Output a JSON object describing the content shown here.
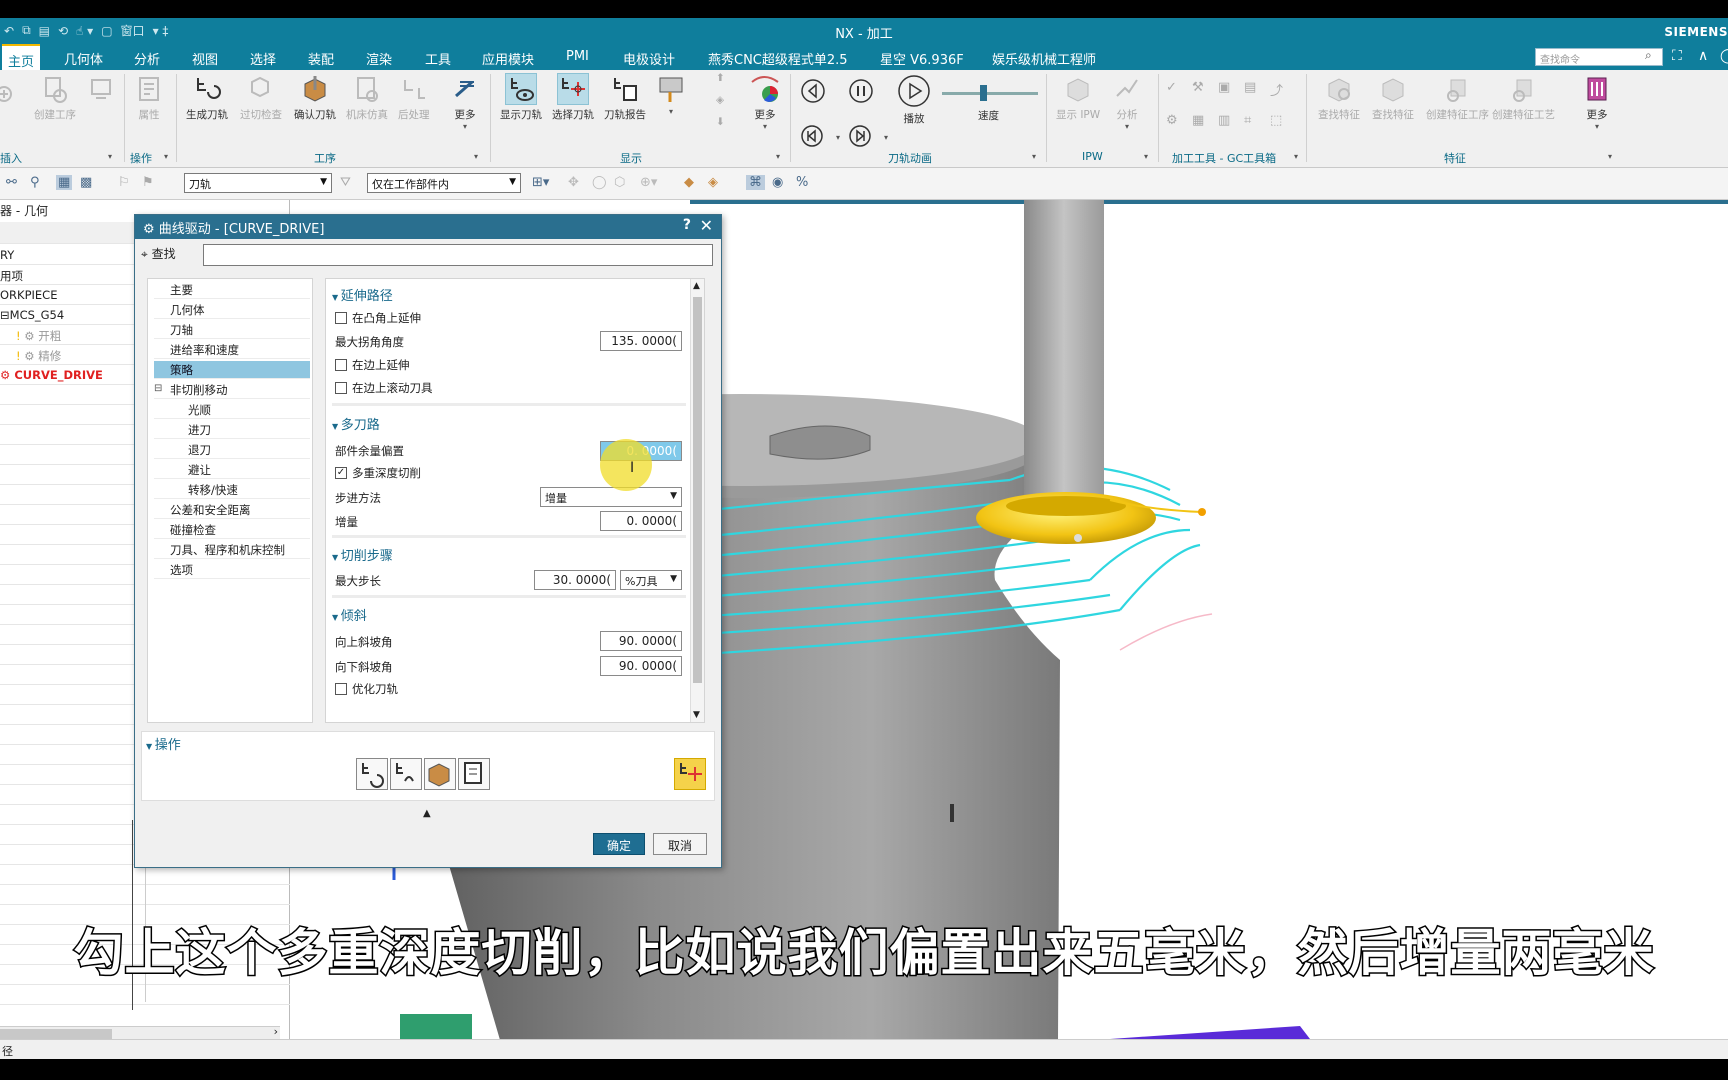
{
  "window": {
    "title": "NX - 加工",
    "brand": "SIEMENS",
    "quick_access": [
      "窗口"
    ]
  },
  "menu": {
    "items": [
      "主页",
      "几何体",
      "分析",
      "视图",
      "选择",
      "装配",
      "渲染",
      "工具",
      "应用模块",
      "PMI",
      "电极设计",
      "燕秀CNC超级程式单2.5",
      "星空 V6.936F",
      "娱乐级机械工程师"
    ],
    "search_placeholder": "查找命令"
  },
  "ribbon": {
    "buttons": {
      "create_op": "创建工序",
      "attr": "属性",
      "gen": "生成刀轨",
      "verify_dis": "过切检查",
      "confirm": "确认刀轨",
      "sim": "机床仿真",
      "post": "后处理",
      "more1": "更多",
      "show_path": "显示刀轨",
      "select_path": "选择刀轨",
      "report": "刀轨报告",
      "more2": "更多",
      "play": "播放",
      "speed": "速度",
      "show_ipw": "显示 IPW",
      "analysis": "分析",
      "find_feat": "查找特征",
      "feat2": "查找特征",
      "create_feat": "创建特征工序",
      "create_feat2": "创建特征工艺",
      "more3": "更多"
    },
    "groups": {
      "insert": "插入",
      "operation": "操作",
      "process": "工序",
      "display": "显示",
      "anim": "刀轨动画",
      "ipw": "IPW",
      "gc": "加工工具 - GC工具箱",
      "feature": "特征"
    }
  },
  "selbar": {
    "filter": "刀轨",
    "scope": "仅在工作部件内"
  },
  "navigator": {
    "header": "器 - 几何",
    "rows": [
      "RY",
      "用项",
      "ORKPIECE",
      "MCS_G54",
      "开粗",
      "精修",
      "CURVE_DRIVE"
    ]
  },
  "status": {
    "text": "径"
  },
  "dialog": {
    "title": "曲线驱动 - [CURVE_DRIVE]",
    "help": "?",
    "find_label": "查找",
    "tree": [
      "主要",
      "几何体",
      "刀轴",
      "进给率和速度",
      "策略",
      "非切削移动",
      "光顺",
      "进刀",
      "退刀",
      "避让",
      "转移/快速",
      "公差和安全距离",
      "碰撞检查",
      "刀具、程序和机床控制",
      "选项"
    ],
    "extend": {
      "title": "延伸路径",
      "convex": "在凸角上延伸",
      "max_angle_label": "最大拐角角度",
      "max_angle": "135. 0000(",
      "edge_extend": "在边上延伸",
      "edge_roll": "在边上滚动刀具"
    },
    "multi": {
      "title": "多刀路",
      "offset_label": "部件余量偏置",
      "offset": "0. 0000(",
      "depth_label": "多重深度切削",
      "step_label": "步进方法",
      "step": "增量",
      "inc_label": "增量",
      "inc": "0. 0000("
    },
    "cutstep": {
      "title": "切削步骤",
      "max_label": "最大步长",
      "max": "30. 0000(",
      "unit": "%刀具"
    },
    "tilt": {
      "title": "倾斜",
      "up_label": "向上斜坡角",
      "up": "90. 0000(",
      "down_label": "向下斜坡角",
      "down": "90. 0000(",
      "opt": "优化刀轨"
    },
    "ops_title": "操作",
    "ok": "确定",
    "cancel": "取消"
  },
  "subtitle": "勾上这个多重深度切削，比如说我们偏置出来五毫米，然后增量两毫米",
  "colors": {
    "chrome": "#0f7e9c",
    "dialog_title": "#2a6f8f",
    "toolpath": "#2fd6e0",
    "tool": "#f2c414"
  }
}
